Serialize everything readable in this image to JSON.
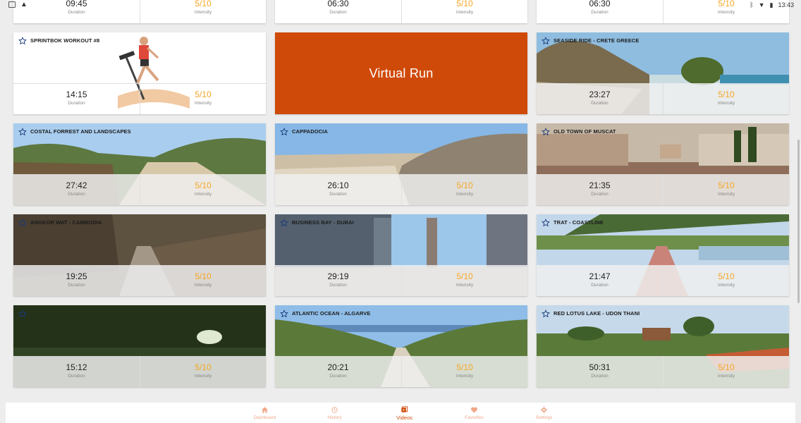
{
  "status_bar": {
    "time": "13:43"
  },
  "labels": {
    "duration": "Duration",
    "intensity": "Intensity"
  },
  "workouts": [
    {
      "title": "",
      "duration": "09:45",
      "intensity": "5/10",
      "scene": "treadmill-top"
    },
    {
      "title": "",
      "duration": "06:30",
      "intensity": "5/10",
      "scene": "treadmill-top"
    },
    {
      "title": "",
      "duration": "06:30",
      "intensity": "5/10",
      "scene": "treadmill-top"
    },
    {
      "title": "SPRINTBOK WORKOUT #8",
      "duration": "14:15",
      "intensity": "5/10",
      "scene": "treadmill"
    },
    {
      "title": "Virtual Run",
      "scene": "promo"
    },
    {
      "title": "SEASIDE RIDE - CRETE GREECE",
      "duration": "23:27",
      "intensity": "5/10",
      "scene": "seaside"
    },
    {
      "title": "COSTAL FORREST AND LANDSCAPES",
      "duration": "27:42",
      "intensity": "5/10",
      "scene": "forest-coast"
    },
    {
      "title": "CAPPADOCIA",
      "duration": "26:10",
      "intensity": "5/10",
      "scene": "cappadocia"
    },
    {
      "title": "OLD TOWN OF MUSCAT",
      "duration": "21:35",
      "intensity": "5/10",
      "scene": "muscat"
    },
    {
      "title": "ANGKOR WAT - CAMBODIA",
      "duration": "19:25",
      "intensity": "5/10",
      "scene": "angkor"
    },
    {
      "title": "BUSINESS BAY - DUBAI",
      "duration": "29:19",
      "intensity": "5/10",
      "scene": "dubai"
    },
    {
      "title": "TRAT - COASTLINE",
      "duration": "21:47",
      "intensity": "5/10",
      "scene": "trat"
    },
    {
      "title": "",
      "duration": "15:12",
      "intensity": "5/10",
      "scene": "dark-forest"
    },
    {
      "title": "ATLANTIC OCEAN - ALGARVE",
      "duration": "20:21",
      "intensity": "5/10",
      "scene": "algarve"
    },
    {
      "title": "RED LOTUS LAKE - UDON THANI",
      "duration": "50:31",
      "intensity": "5/10",
      "scene": "lotus"
    }
  ],
  "nav": [
    {
      "label": "Dashboard",
      "icon": "home-icon",
      "active": false
    },
    {
      "label": "History",
      "icon": "history-icon",
      "active": false
    },
    {
      "label": "Videos",
      "icon": "videos-icon",
      "active": true
    },
    {
      "label": "Favorites",
      "icon": "heart-icon",
      "active": false
    },
    {
      "label": "Settings",
      "icon": "gear-icon",
      "active": false
    }
  ],
  "colors": {
    "accent": "#cf4a09",
    "intensity": "#f5a623",
    "nav_inactive": "#f0a889"
  }
}
